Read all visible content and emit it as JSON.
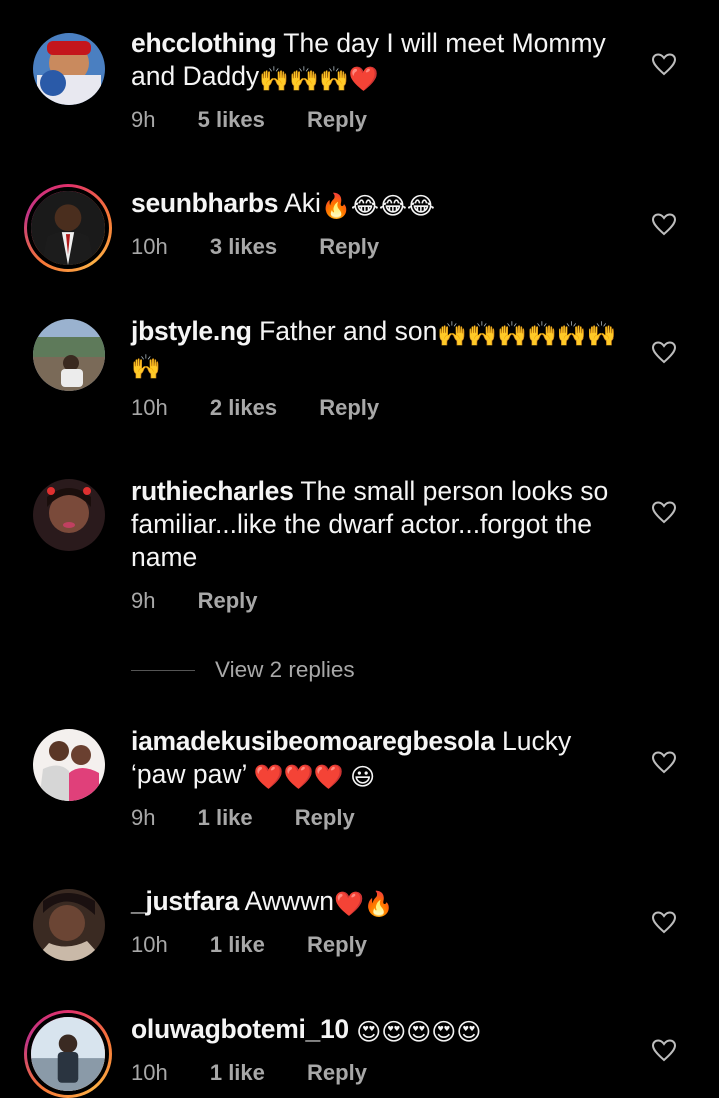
{
  "comments": [
    {
      "username": "ehcclothing",
      "text": "The day I will meet Mommy and Daddy",
      "emojis": "🙌🙌🙌❤️",
      "time": "9h",
      "likes": "5 likes",
      "reply": "Reply",
      "icon": "heart-outline-icon"
    },
    {
      "username": "seunbharbs",
      "text": "Aki",
      "emojis": "🔥😂😂😂",
      "time": "10h",
      "likes": "3 likes",
      "reply": "Reply",
      "icon": "heart-outline-icon"
    },
    {
      "username": "jbstyle.ng",
      "text": "Father and son",
      "emojis": "🙌🙌🙌🙌🙌🙌",
      "emojis2": "🙌",
      "time": "10h",
      "likes": "2 likes",
      "reply": "Reply",
      "icon": "heart-outline-icon"
    },
    {
      "username": "ruthiecharles",
      "text": "The small person looks so familiar...like the dwarf actor...forgot the name",
      "time": "9h",
      "reply": "Reply",
      "icon": "heart-outline-icon"
    },
    {
      "username": "iamadekusibeomoaregbesola",
      "text": "Lucky ‘paw paw’",
      "emojis": "❤️❤️❤️ 😃",
      "time": "9h",
      "likes": "1 like",
      "reply": "Reply",
      "icon": "heart-outline-icon"
    },
    {
      "username": "_justfara",
      "text": "Awwwn",
      "emojis": "❤️🔥",
      "time": "10h",
      "likes": "1 like",
      "reply": "Reply",
      "icon": "heart-outline-icon"
    },
    {
      "username": "oluwagbotemi_10",
      "text": "",
      "emojis": "😍😍😍😍😍",
      "time": "10h",
      "likes": "1 like",
      "reply": "Reply",
      "icon": "heart-outline-icon"
    }
  ],
  "view_replies": "View 2 replies",
  "colors": {
    "background": "#000000",
    "text": "#f5f5f5",
    "muted": "#a8a8a8",
    "ring": "#e1306c"
  }
}
